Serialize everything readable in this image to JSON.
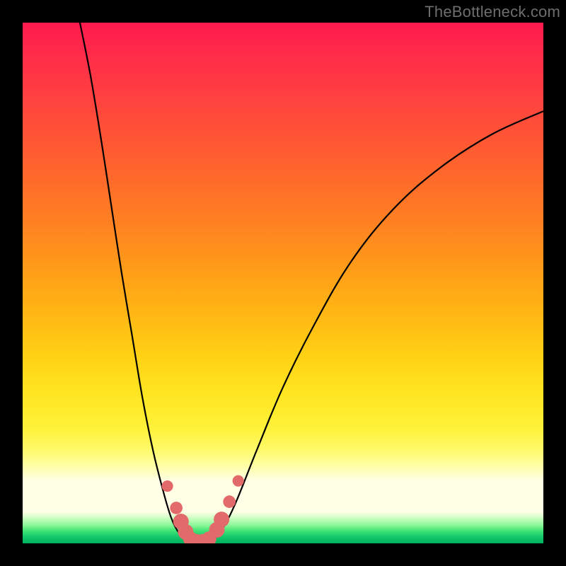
{
  "watermark": "TheBottleneck.com",
  "chart_data": {
    "type": "line",
    "title": "",
    "xlabel": "",
    "ylabel": "",
    "xlim": [
      0,
      100
    ],
    "ylim": [
      0,
      100
    ],
    "grid": false,
    "legend": false,
    "background": {
      "stops": [
        {
          "pct": 0,
          "color": "#ff1a4d"
        },
        {
          "pct": 24,
          "color": "#ff5a32"
        },
        {
          "pct": 46,
          "color": "#ff981a"
        },
        {
          "pct": 72,
          "color": "#ffe724"
        },
        {
          "pct": 88,
          "color": "#ffffe6"
        },
        {
          "pct": 97,
          "color": "#46e676"
        },
        {
          "pct": 100,
          "color": "#00b060"
        }
      ]
    },
    "series": [
      {
        "name": "left-curve",
        "stroke": "#000000",
        "points": [
          {
            "x": 11.0,
            "y": 100.0
          },
          {
            "x": 13.0,
            "y": 90.0
          },
          {
            "x": 15.0,
            "y": 78.0
          },
          {
            "x": 17.0,
            "y": 65.0
          },
          {
            "x": 19.0,
            "y": 52.0
          },
          {
            "x": 21.0,
            "y": 40.0
          },
          {
            "x": 23.0,
            "y": 28.0
          },
          {
            "x": 25.0,
            "y": 18.0
          },
          {
            "x": 27.0,
            "y": 10.0
          },
          {
            "x": 28.5,
            "y": 5.0
          },
          {
            "x": 30.0,
            "y": 2.0
          },
          {
            "x": 31.5,
            "y": 0.5
          }
        ]
      },
      {
        "name": "right-curve",
        "stroke": "#000000",
        "points": [
          {
            "x": 36.5,
            "y": 0.5
          },
          {
            "x": 38.5,
            "y": 3.0
          },
          {
            "x": 41.0,
            "y": 8.0
          },
          {
            "x": 45.0,
            "y": 18.0
          },
          {
            "x": 50.0,
            "y": 30.0
          },
          {
            "x": 56.0,
            "y": 42.0
          },
          {
            "x": 63.0,
            "y": 54.0
          },
          {
            "x": 71.0,
            "y": 64.0
          },
          {
            "x": 80.0,
            "y": 72.0
          },
          {
            "x": 90.0,
            "y": 78.5
          },
          {
            "x": 100.0,
            "y": 83.0
          }
        ]
      }
    ],
    "markers": [
      {
        "x": 27.8,
        "y": 11.0,
        "r": 1.1
      },
      {
        "x": 29.5,
        "y": 6.8,
        "r": 1.2
      },
      {
        "x": 30.4,
        "y": 4.2,
        "r": 1.5
      },
      {
        "x": 31.3,
        "y": 2.2,
        "r": 1.5
      },
      {
        "x": 32.2,
        "y": 0.9,
        "r": 1.4
      },
      {
        "x": 33.4,
        "y": 0.5,
        "r": 1.3
      },
      {
        "x": 34.6,
        "y": 0.5,
        "r": 1.3
      },
      {
        "x": 35.8,
        "y": 0.9,
        "r": 1.4
      },
      {
        "x": 37.3,
        "y": 2.6,
        "r": 1.5
      },
      {
        "x": 38.2,
        "y": 4.6,
        "r": 1.5
      },
      {
        "x": 39.7,
        "y": 8.0,
        "r": 1.2
      },
      {
        "x": 41.4,
        "y": 12.0,
        "r": 1.1
      }
    ],
    "marker_color": "#e36a6a"
  }
}
